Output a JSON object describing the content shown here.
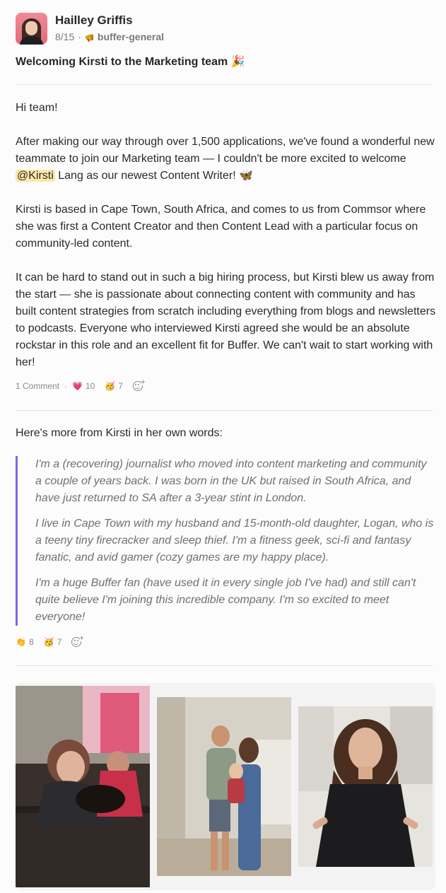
{
  "post": {
    "author": "Hailley Griffis",
    "date": "8/15",
    "separator": "·",
    "channel": "buffer-general",
    "title": "Welcoming Kirsti to the Marketing team 🎉",
    "greeting": "Hi team!",
    "p1_before": "After making our way through over 1,500 applications, we've found a wonderful new teammate to join our Marketing team — I couldn't be more excited to welcome ",
    "mention": "@Kirsti",
    "p1_after": " Lang as our newest Content Writer! 🦋",
    "p2": "Kirsti is based in Cape Town, South Africa, and comes to us from Commsor where she was first a Content Creator and then Content Lead with a particular focus on community-led content.",
    "p3": "It can be hard to stand out in such a big hiring process, but Kirsti blew us away from the start — she is passionate about connecting content with community and has built content strategies from scratch including everything from blogs and newsletters to podcasts. Everyone who interviewed Kirsti agreed she would be an absolute rockstar in this role and an excellent fit for Buffer. We can't wait to start working with her!"
  },
  "post_reactions": {
    "comments": "1 Comment",
    "dot": "·",
    "heart_emoji": "💗",
    "heart_count": "10",
    "party_emoji": "🥳",
    "party_count": "7"
  },
  "followup": {
    "intro": "Here's more from Kirsti in her own words:",
    "quote": [
      "I'm a (recovering) journalist who moved into content marketing and community a couple of years back. I was born in the UK but raised in South Africa, and have just returned to SA after a 3-year stint in London.",
      "I live in Cape Town with my husband and 15-month-old daughter, Logan, who is a teeny tiny firecracker and sleep thief. I'm a fitness geek, sci-fi and fantasy fanatic, and avid gamer (cozy games are my happy place).",
      "I'm a huge Buffer fan (have used it in every single job I've had) and still can't quite believe I'm joining this incredible company. I'm so excited to meet everyone!"
    ]
  },
  "followup_reactions": {
    "wave_emoji": "👏",
    "wave_count": "8",
    "party_emoji": "🥳",
    "party_count": "7"
  },
  "colors": {
    "quote_border": "#7a6ae0",
    "mention_bg": "#fde9a6",
    "divider": "#e2e2e4"
  }
}
